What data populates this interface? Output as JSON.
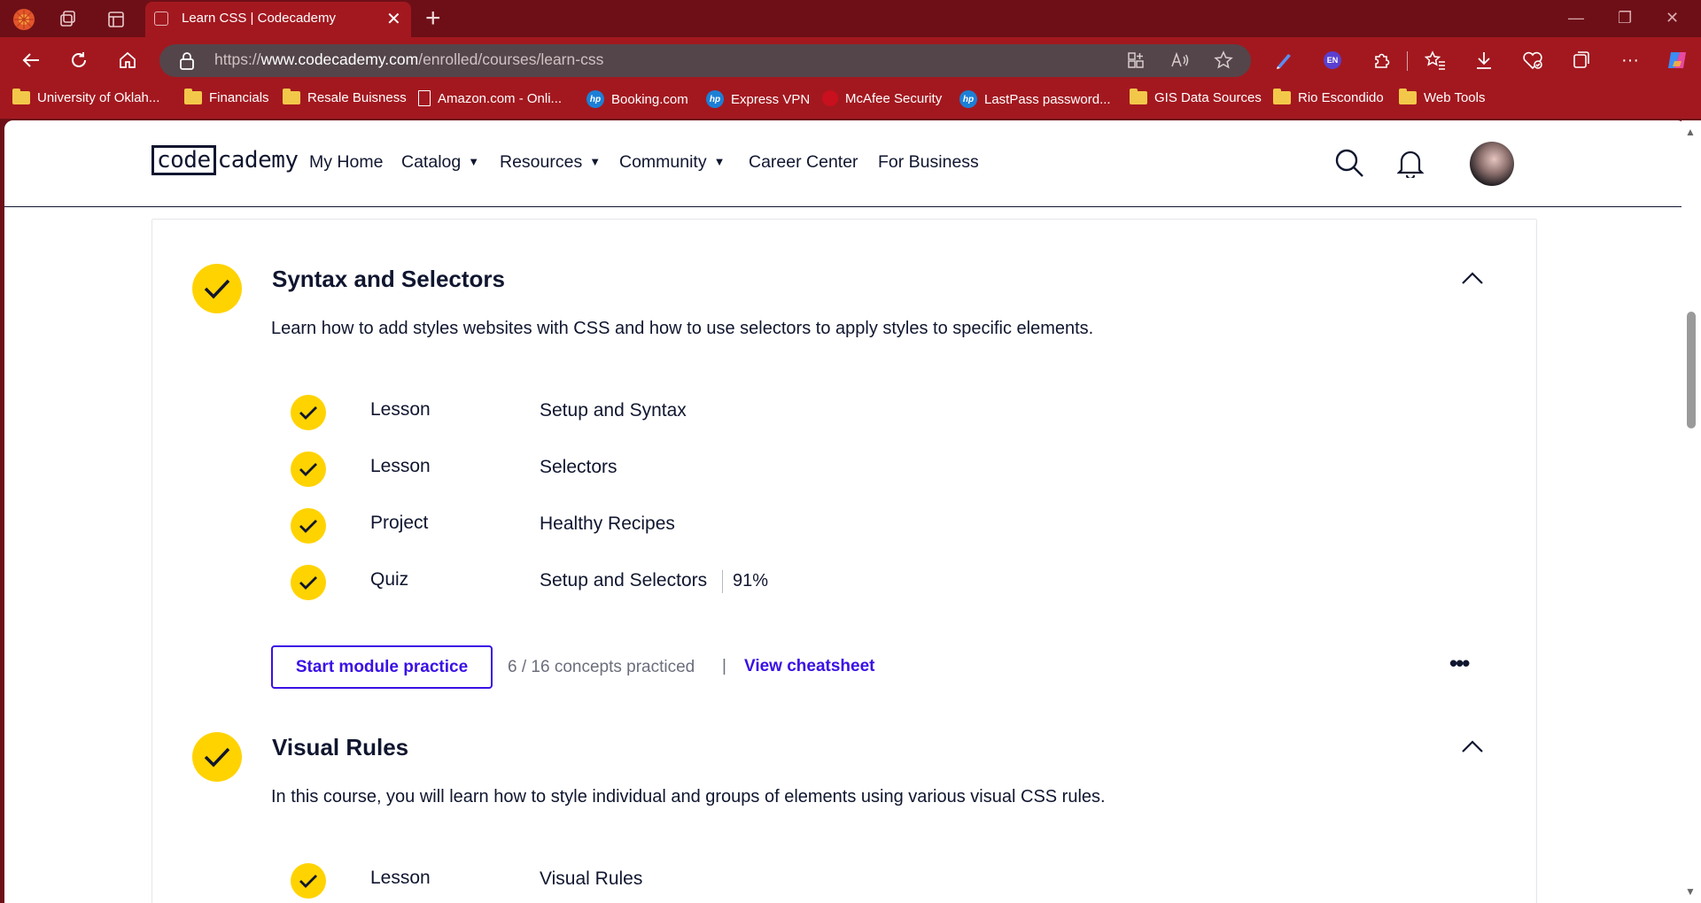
{
  "browser": {
    "tab_title": "Learn CSS | Codecademy",
    "url_prefix": "https://",
    "url_host": "www.codecademy.com",
    "url_path": "/enrolled/courses/learn-css",
    "extension_label": "EN",
    "bookmarks": [
      {
        "label": "University of Oklah...",
        "icon": "folder-icon"
      },
      {
        "label": "Financials",
        "icon": "folder-icon"
      },
      {
        "label": "Resale Buisness",
        "icon": "folder-icon"
      },
      {
        "label": "Amazon.com - Onli...",
        "icon": "page-icon"
      },
      {
        "label": "Booking.com",
        "icon": "hp-icon"
      },
      {
        "label": "Express VPN",
        "icon": "hp-icon"
      },
      {
        "label": "McAfee Security",
        "icon": "mcafee-icon"
      },
      {
        "label": "LastPass password...",
        "icon": "hp-icon"
      },
      {
        "label": "GIS Data Sources",
        "icon": "folder-icon"
      },
      {
        "label": "Rio Escondido",
        "icon": "folder-icon"
      },
      {
        "label": "Web Tools",
        "icon": "folder-icon"
      }
    ]
  },
  "site": {
    "logo_box": "code",
    "logo_rest": "cademy",
    "nav": {
      "my_home": "My Home",
      "catalog": "Catalog",
      "resources": "Resources",
      "community": "Community",
      "career_center": "Career Center",
      "for_business": "For Business"
    }
  },
  "modules": [
    {
      "title": "Syntax and Selectors",
      "description": "Learn how to add styles websites with CSS and how to use selectors to apply styles to specific elements.",
      "items": [
        {
          "type": "Lesson",
          "name": "Setup and Syntax"
        },
        {
          "type": "Lesson",
          "name": "Selectors"
        },
        {
          "type": "Project",
          "name": "Healthy Recipes"
        },
        {
          "type": "Quiz",
          "name": "Setup and Selectors",
          "score": "91%"
        }
      ],
      "practice_button": "Start module practice",
      "concepts": "6 / 16 concepts practiced",
      "separator": "|",
      "cheatsheet": "View cheatsheet"
    },
    {
      "title": "Visual Rules",
      "description": "In this course, you will learn how to style individual and groups of elements using various visual CSS rules.",
      "items": [
        {
          "type": "Lesson",
          "name": "Visual Rules"
        }
      ]
    }
  ]
}
